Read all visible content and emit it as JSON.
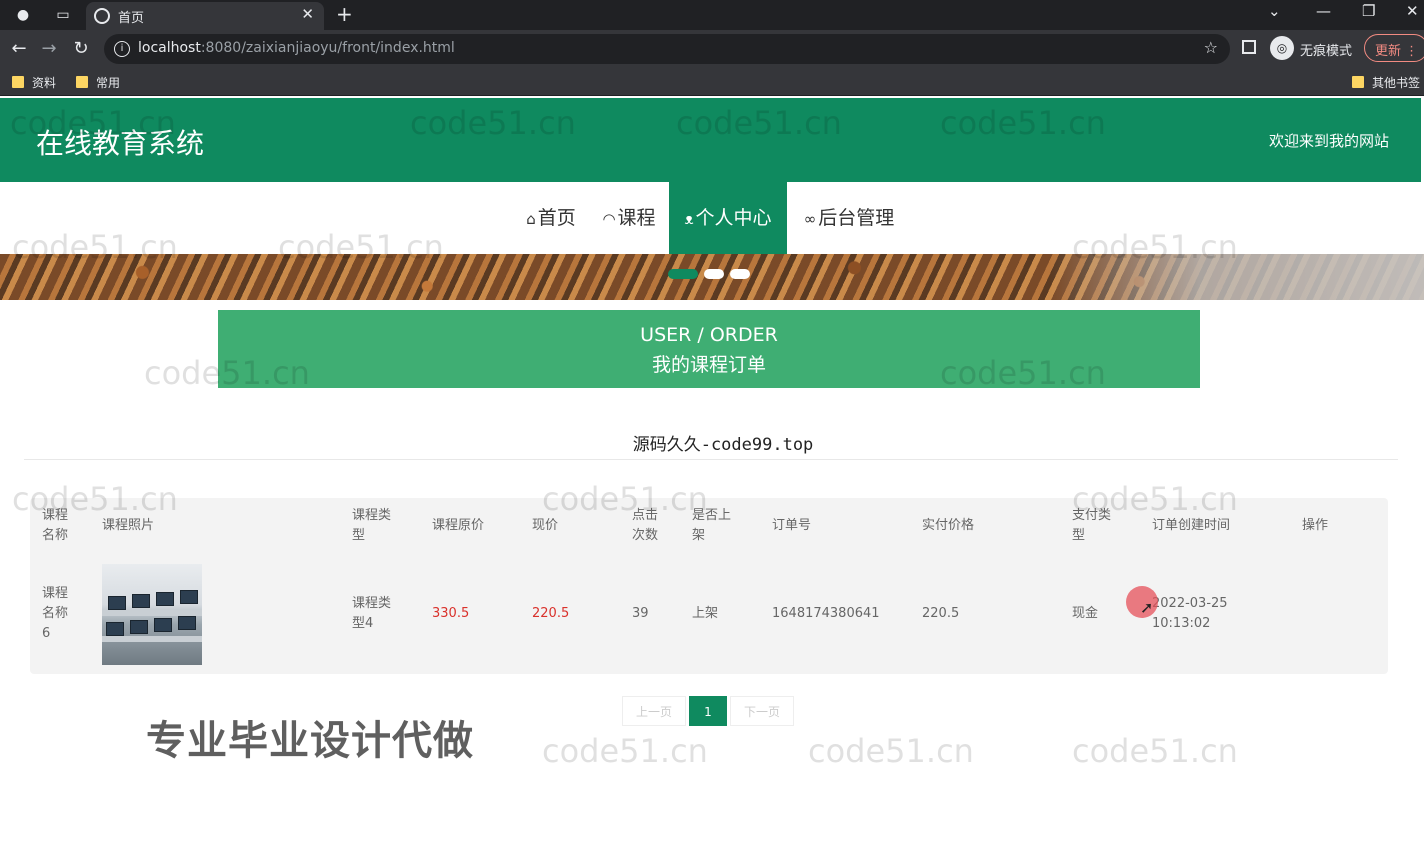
{
  "browser": {
    "tab_title": "首页",
    "url_host": "localhost",
    "url_rest": ":8080/zaixianjiaoyu/front/index.html",
    "incognito_label": "无痕模式",
    "update_label": "更新",
    "bookmarks": [
      "资料",
      "常用"
    ],
    "other_bookmarks": "其他书签"
  },
  "site": {
    "title": "在线教育系统",
    "welcome": "欢迎来到我的网站",
    "brand_color": "#0f8a5f"
  },
  "nav": {
    "items": [
      {
        "icon": "⌂",
        "label": "首页"
      },
      {
        "icon": "◠",
        "label": "课程"
      },
      {
        "icon": "ᴥ",
        "label": "个人中心",
        "active": true
      },
      {
        "icon": "∞",
        "label": "后台管理"
      }
    ]
  },
  "section": {
    "en": "USER / ORDER",
    "zh": "我的课程订单"
  },
  "subtitle": "源码久久-code99.top",
  "table": {
    "headers": [
      "课程名称",
      "课程照片",
      "课程类型",
      "课程原价",
      "现价",
      "点击次数",
      "是否上架",
      "订单号",
      "实付价格",
      "支付类型",
      "订单创建时间",
      "操作"
    ],
    "rows": [
      {
        "name": "课程名称6",
        "type": "课程类型4",
        "original_price": "330.5",
        "price": "220.5",
        "clicks": "39",
        "listed": "上架",
        "order_no": "1648174380641",
        "paid": "220.5",
        "pay_type": "现金",
        "created": "2022-03-25 10:13:02",
        "action": ""
      }
    ]
  },
  "pager": {
    "prev": "上一页",
    "current": "1",
    "next": "下一页"
  },
  "overlay_text": "专业毕业设计代做",
  "watermark": "code51.cn"
}
